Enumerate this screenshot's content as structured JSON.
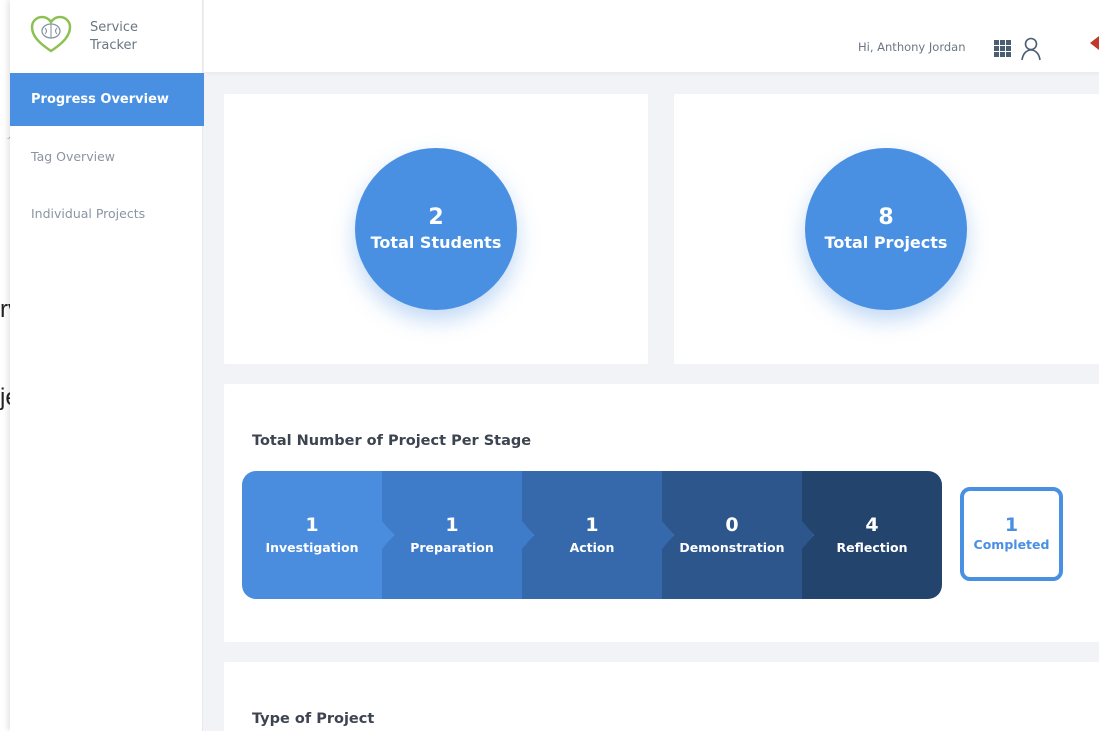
{
  "background_fragments": {
    "overview_tail": "rview",
    "projects_tail": "jects"
  },
  "app": {
    "brand": {
      "line1": "Service",
      "line2": "Tracker",
      "logo_icon": "heart-brain-icon"
    },
    "sidebar": {
      "items": [
        {
          "label": "Progress Overview",
          "active": true
        },
        {
          "label": "Tag Overview",
          "active": false
        },
        {
          "label": "Individual Projects",
          "active": false
        }
      ]
    },
    "header": {
      "greeting": "Hi, Anthony Jordan",
      "apps_icon": "grid-icon",
      "user_icon": "user-icon"
    },
    "summary": {
      "students": {
        "value": "2",
        "label": "Total Students"
      },
      "projects": {
        "value": "8",
        "label": "Total Projects"
      }
    },
    "stages_section": {
      "title": "Total Number of Project Per Stage",
      "stages": [
        {
          "value": "1",
          "label": "Investigation"
        },
        {
          "value": "1",
          "label": "Preparation"
        },
        {
          "value": "1",
          "label": "Action"
        },
        {
          "value": "0",
          "label": "Demonstration"
        },
        {
          "value": "4",
          "label": "Reflection"
        }
      ],
      "completed": {
        "value": "1",
        "label": "Completed"
      }
    },
    "type_section": {
      "title": "Type of Project"
    }
  },
  "colors": {
    "accent": "#4a90e2",
    "stage_1": "#4a8cde",
    "stage_2": "#3e7bc8",
    "stage_3": "#3569ac",
    "stage_4": "#2c568c",
    "stage_5": "#23446d"
  }
}
